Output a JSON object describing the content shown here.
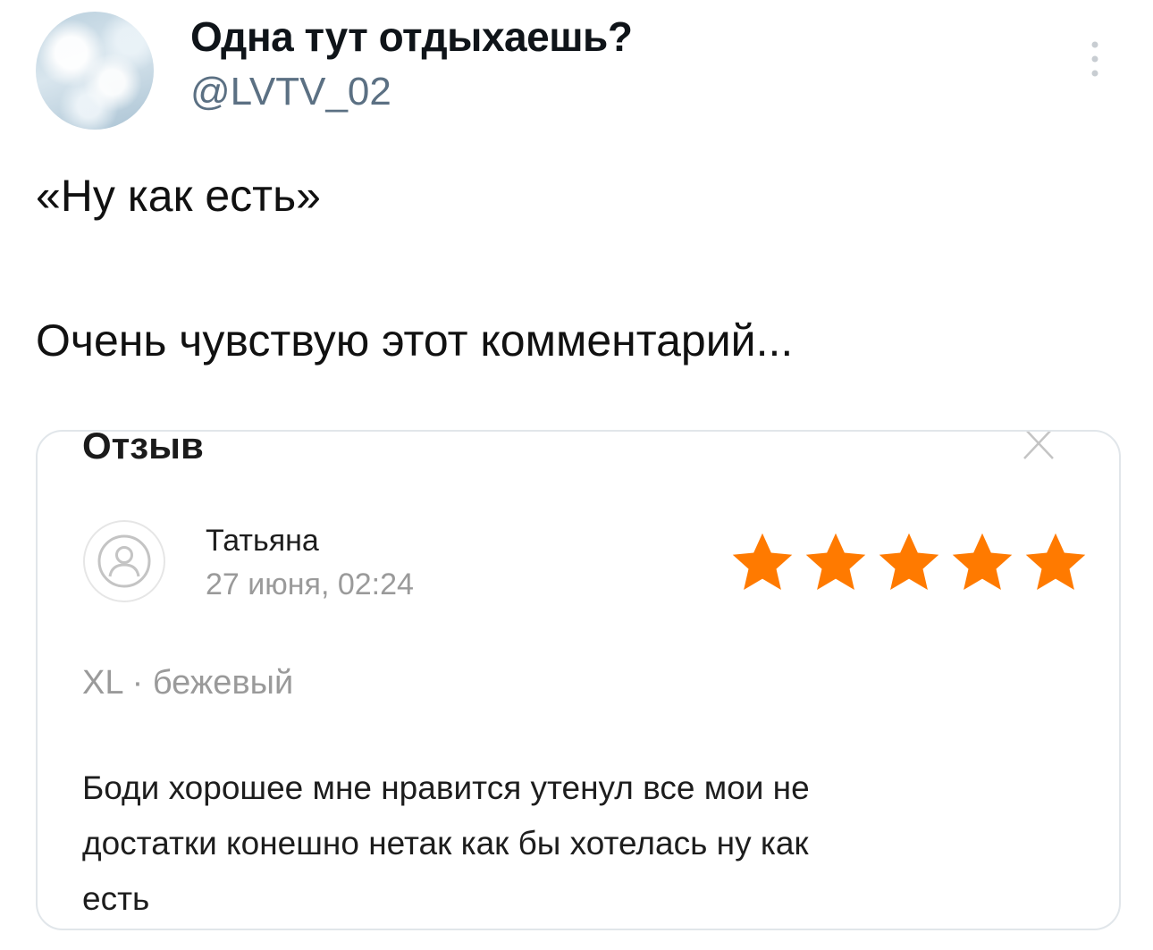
{
  "tweet": {
    "author_name": "Одна тут отдыхаешь?",
    "author_handle": "@LVTV_02",
    "more_icon": "more-vertical-icon",
    "text_lines": [
      "«Ну как есть»",
      "Очень чувствую этот комментарий..."
    ]
  },
  "review_card": {
    "title": "Отзыв",
    "close_icon": "close-icon",
    "reviewer_avatar_icon": "user-avatar-icon",
    "reviewer_name": "Татьяна",
    "date": "27 июня, 02:24",
    "rating": 5,
    "rating_max": 5,
    "star_color": "#ff7a00",
    "variant": "XL · бежевый",
    "body_lines": [
      "Боди хорошее мне нравится утенул все мои не",
      "достатки конешно нетак как бы хотелась ну как",
      "есть"
    ]
  }
}
